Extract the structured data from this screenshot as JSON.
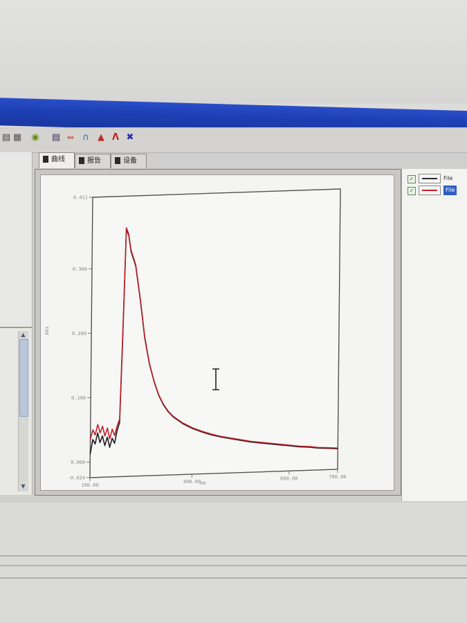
{
  "toolbar": {
    "icons": [
      "folder-icon",
      "save-icon",
      "print-icon",
      "chart-icon",
      "peak-icon",
      "spectrum-icon",
      "bar-icon",
      "triangle-icon",
      "cross-icon"
    ]
  },
  "tabs": [
    {
      "label": "曲线"
    },
    {
      "label": "报告"
    },
    {
      "label": "设备"
    }
  ],
  "legend": [
    {
      "label": "File",
      "checked": true,
      "color": "#2b2b2b",
      "selected": false
    },
    {
      "label": "File",
      "checked": true,
      "color": "#c0202a",
      "selected": true
    }
  ],
  "colors": {
    "title_bar": "#1d3fb4",
    "series_black": "#1c1c1c",
    "series_red": "#c0202a"
  },
  "chart_data": {
    "type": "line",
    "xlabel": "nm",
    "ylabel": "Abs",
    "xlim": [
      190.0,
      700.0
    ],
    "ylim": [
      -0.024,
      0.411
    ],
    "x_ticks": [
      "190.00",
      "400.00",
      "600.00",
      "700.00"
    ],
    "y_ticks": [
      "0.411",
      "0.300",
      "0.200",
      "0.100",
      "0.000",
      "-0.024"
    ],
    "grid": false,
    "series": [
      {
        "color": "#1c1c1c",
        "x": [
          190,
          195,
          200,
          205,
          210,
          215,
          220,
          225,
          230,
          235,
          240,
          245,
          250,
          255,
          260,
          265,
          270,
          280,
          290,
          300,
          310,
          320,
          330,
          340,
          350,
          360,
          380,
          400,
          420,
          440,
          460,
          480,
          500,
          520,
          540,
          560,
          580,
          600,
          620,
          640,
          660,
          680,
          700
        ],
        "y": [
          0.012,
          0.035,
          0.028,
          0.045,
          0.03,
          0.04,
          0.025,
          0.038,
          0.022,
          0.036,
          0.028,
          0.048,
          0.06,
          0.2,
          0.36,
          0.35,
          0.325,
          0.302,
          0.25,
          0.19,
          0.15,
          0.122,
          0.1,
          0.085,
          0.074,
          0.066,
          0.055,
          0.047,
          0.041,
          0.036,
          0.032,
          0.029,
          0.026,
          0.023,
          0.021,
          0.019,
          0.017,
          0.015,
          0.013,
          0.012,
          0.01,
          0.009,
          0.008
        ]
      },
      {
        "color": "#c0202a",
        "x": [
          190,
          195,
          200,
          205,
          210,
          215,
          220,
          225,
          230,
          235,
          240,
          245,
          250,
          255,
          260,
          265,
          270,
          280,
          290,
          300,
          310,
          320,
          330,
          340,
          350,
          360,
          380,
          400,
          420,
          440,
          460,
          480,
          500,
          520,
          540,
          560,
          580,
          600,
          620,
          640,
          660,
          680,
          700
        ],
        "y": [
          0.035,
          0.05,
          0.042,
          0.058,
          0.045,
          0.055,
          0.04,
          0.052,
          0.035,
          0.05,
          0.04,
          0.055,
          0.065,
          0.205,
          0.362,
          0.352,
          0.327,
          0.304,
          0.252,
          0.192,
          0.151,
          0.123,
          0.101,
          0.086,
          0.075,
          0.067,
          0.056,
          0.048,
          0.042,
          0.037,
          0.033,
          0.03,
          0.027,
          0.024,
          0.022,
          0.02,
          0.018,
          0.016,
          0.014,
          0.013,
          0.011,
          0.01,
          0.009
        ]
      }
    ]
  }
}
